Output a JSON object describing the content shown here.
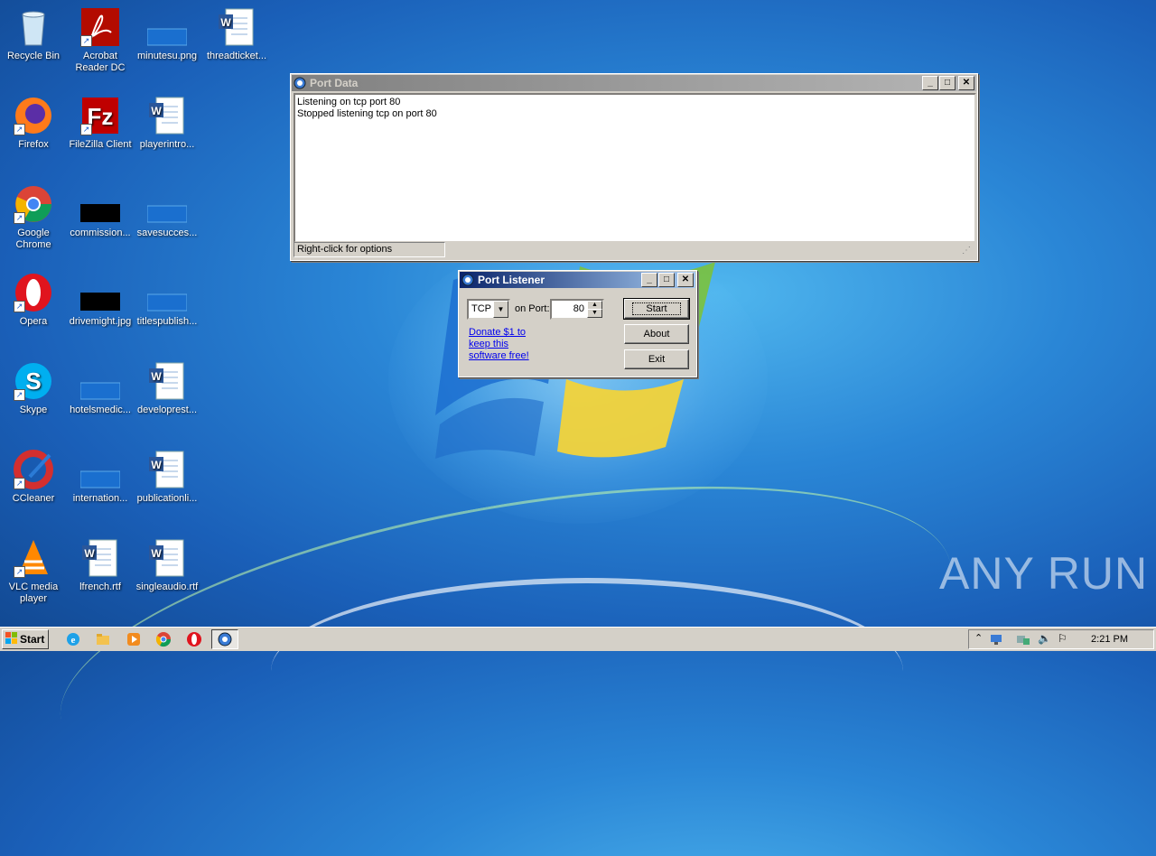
{
  "desktop": {
    "icons": [
      {
        "label": "Recycle Bin",
        "icon": "recycle-bin-icon"
      },
      {
        "label": "Acrobat Reader DC",
        "icon": "acrobat-icon"
      },
      {
        "label": "minutesu.png",
        "icon": "image-file-icon"
      },
      {
        "label": "threadticket...",
        "icon": "word-doc-icon"
      },
      {
        "label": "Firefox",
        "icon": "firefox-icon"
      },
      {
        "label": "FileZilla Client",
        "icon": "filezilla-icon"
      },
      {
        "label": "playerintro...",
        "icon": "word-doc-icon"
      },
      {
        "label": "Google Chrome",
        "icon": "chrome-icon"
      },
      {
        "label": "commission...",
        "icon": "image-file-icon"
      },
      {
        "label": "savesucces...",
        "icon": "image-file-icon"
      },
      {
        "label": "Opera",
        "icon": "opera-icon"
      },
      {
        "label": "drivemight.jpg",
        "icon": "image-file-icon"
      },
      {
        "label": "titlespublish...",
        "icon": "image-file-icon"
      },
      {
        "label": "Skype",
        "icon": "skype-icon"
      },
      {
        "label": "hotelsmedic...",
        "icon": "image-file-icon"
      },
      {
        "label": "developrest...",
        "icon": "word-doc-icon"
      },
      {
        "label": "CCleaner",
        "icon": "ccleaner-icon"
      },
      {
        "label": "internation...",
        "icon": "image-file-icon"
      },
      {
        "label": "publicationli...",
        "icon": "word-doc-icon"
      },
      {
        "label": "VLC media player",
        "icon": "vlc-icon"
      },
      {
        "label": "lfrench.rtf",
        "icon": "word-doc-icon"
      },
      {
        "label": "singleaudio.rtf",
        "icon": "word-doc-icon"
      }
    ]
  },
  "port_data_window": {
    "title": "Port Data",
    "log_lines": [
      "Listening on tcp port 80",
      "Stopped listening tcp on port 80"
    ],
    "status": "Right-click for options"
  },
  "port_listener_window": {
    "title": "Port Listener",
    "protocol": "TCP",
    "on_port_label": "on Port:",
    "port_value": "80",
    "donate_link": [
      "Donate $1 to",
      "keep this",
      "software free!"
    ],
    "buttons": {
      "start": "Start",
      "about": "About",
      "exit": "Exit"
    }
  },
  "taskbar": {
    "start_label": "Start",
    "clock": "2:21 PM"
  },
  "watermark": "ANY RUN"
}
